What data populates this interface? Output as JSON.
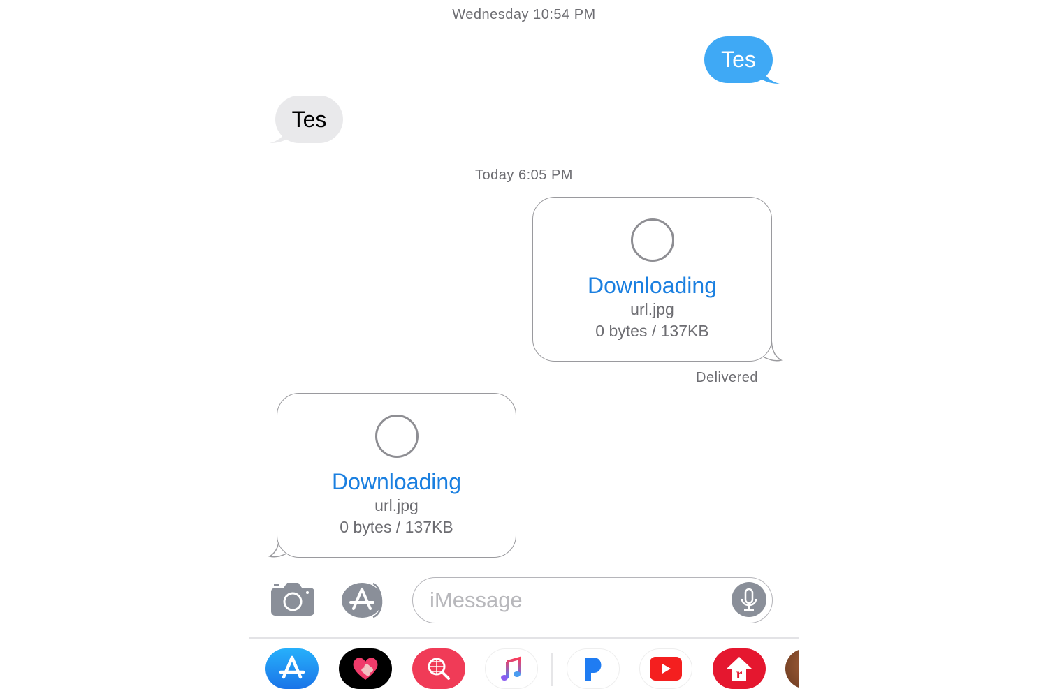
{
  "conversation": {
    "timestamps": [
      "Wednesday 10:54 PM",
      "Today 6:05 PM"
    ],
    "messages": [
      {
        "direction": "sent",
        "text": "Tes"
      },
      {
        "direction": "received",
        "text": "Tes"
      }
    ],
    "attachments": [
      {
        "direction": "sent",
        "status": "Downloading",
        "filename": "url.jpg",
        "size": "0 bytes / 137KB",
        "receipt": "Delivered"
      },
      {
        "direction": "received",
        "status": "Downloading",
        "filename": "url.jpg",
        "size": "0 bytes / 137KB"
      }
    ]
  },
  "composer": {
    "placeholder": "iMessage",
    "camera_icon": "camera-icon",
    "apps_icon": "app-store-icon",
    "mic_icon": "microphone-icon"
  },
  "app_tray": {
    "apps": [
      {
        "name": "App Store",
        "icon": "app-store-icon",
        "color": "#1d8cf0"
      },
      {
        "name": "Heart Stickers",
        "icon": "heart-bandage-icon",
        "color": "#000000"
      },
      {
        "name": "Images Search",
        "icon": "globe-search-icon",
        "color": "#f03b57"
      },
      {
        "name": "Music",
        "icon": "music-note-icon",
        "color": "#ffffff"
      },
      {
        "name": "Pandora",
        "icon": "pandora-p-icon",
        "color": "#ffffff"
      },
      {
        "name": "YouTube",
        "icon": "youtube-play-icon",
        "color": "#ffffff"
      },
      {
        "name": "Realtor",
        "icon": "realtor-house-icon",
        "color": "#e5172f"
      },
      {
        "name": "Memoji",
        "icon": "memoji-avatar-icon",
        "color": "#8a4a2a"
      }
    ]
  },
  "colors": {
    "sent_bubble": "#3fa9f5",
    "received_bubble": "#e9e9eb",
    "link_blue": "#1a7fe0",
    "secondary_text": "#6d6d72"
  }
}
